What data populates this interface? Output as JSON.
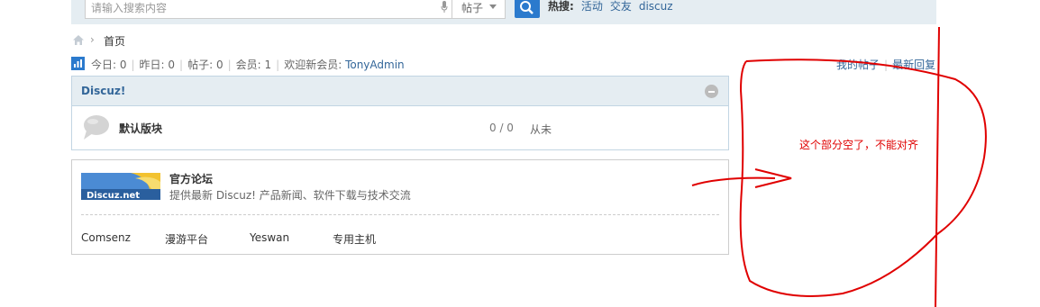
{
  "header": {
    "search": {
      "placeholder": "请输入搜索内容"
    },
    "search_type": "帖子",
    "hot": {
      "label": "热搜:",
      "keywords": [
        "活动",
        "交友",
        "discuz"
      ]
    }
  },
  "breadcrumb": {
    "current": "首页",
    "separator": "›"
  },
  "stats": {
    "today": "今日: 0",
    "yesterday": "昨日: 0",
    "posts": "帖子: 0",
    "members": "会员: 1",
    "welcome_label": "欢迎新会员:",
    "newest_member": "TonyAdmin"
  },
  "top_links": {
    "my_posts": "我的帖子",
    "latest_replies": "最新回复"
  },
  "category": {
    "title": "Discuz!",
    "forums": [
      {
        "name": "默认版块",
        "counts": "0 / 0",
        "last_post": "从未"
      }
    ]
  },
  "links": {
    "logo_text": "Discuz.net",
    "title": "官方论坛",
    "description": "提供最新 Discuz! 产品新闻、软件下载与技术交流",
    "partners": [
      "Comsenz",
      "漫游平台",
      "Yeswan",
      "专用主机"
    ]
  },
  "annotation": {
    "text": "这个部分空了，不能对齐"
  },
  "colors": {
    "accent": "#2b7acd",
    "link": "#336699",
    "header_bg": "#e5edf2",
    "border": "#c2d5e3",
    "annotation": "#e00000"
  }
}
